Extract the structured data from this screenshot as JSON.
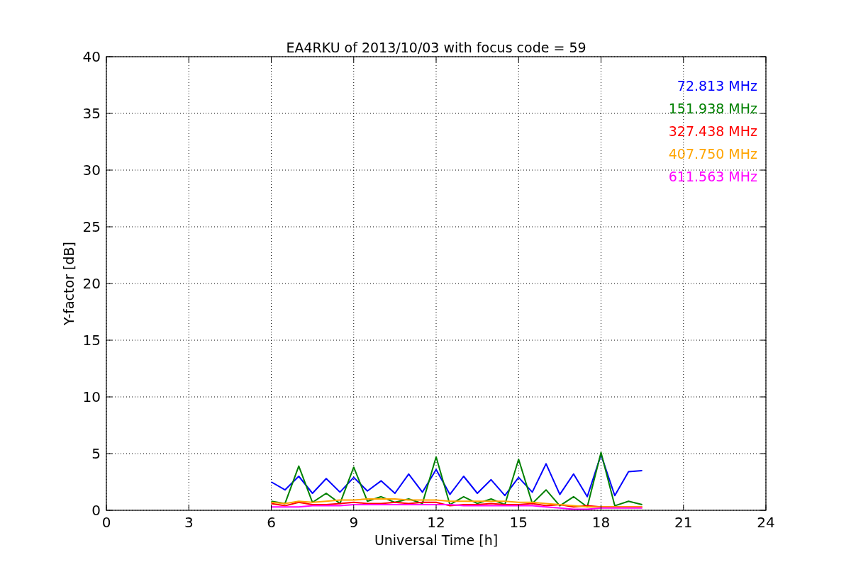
{
  "chart_data": {
    "type": "line",
    "title": "EA4RKU of 2013/10/03 with focus code = 59",
    "xlabel": "Universal Time [h]",
    "ylabel": "Y-factor [dB]",
    "x": [
      6,
      6.5,
      7,
      7.5,
      8,
      8.5,
      9,
      9.5,
      10,
      10.5,
      11,
      11.5,
      12,
      12.5,
      13,
      13.5,
      14,
      14.5,
      15,
      15.5,
      16,
      16.5,
      17,
      17.5,
      18,
      18.5,
      19,
      19.5
    ],
    "series": [
      {
        "name": "72.813 MHz",
        "color": "#0000ff",
        "values": [
          2.5,
          1.8,
          3.0,
          1.5,
          2.8,
          1.6,
          2.9,
          1.7,
          2.6,
          1.5,
          3.2,
          1.6,
          3.6,
          1.4,
          3.0,
          1.5,
          2.7,
          1.3,
          2.9,
          1.6,
          4.1,
          1.4,
          3.2,
          1.2,
          4.9,
          1.3,
          3.4,
          3.5
        ]
      },
      {
        "name": "151.938 MHz",
        "color": "#008000",
        "values": [
          0.8,
          0.6,
          3.9,
          0.7,
          1.5,
          0.6,
          3.8,
          0.8,
          1.2,
          0.7,
          1.0,
          0.6,
          4.7,
          0.5,
          1.2,
          0.6,
          1.0,
          0.5,
          4.5,
          0.6,
          1.8,
          0.4,
          1.2,
          0.3,
          5.1,
          0.4,
          0.8,
          0.5
        ]
      },
      {
        "name": "327.438 MHz",
        "color": "#ff0000",
        "values": [
          0.6,
          0.4,
          0.7,
          0.5,
          0.5,
          0.6,
          0.7,
          0.6,
          0.6,
          0.7,
          0.6,
          0.7,
          0.7,
          0.4,
          0.5,
          0.5,
          0.6,
          0.5,
          0.5,
          0.6,
          0.4,
          0.5,
          0.3,
          0.4,
          0.3,
          0.3,
          0.3,
          0.3
        ]
      },
      {
        "name": "407.750 MHz",
        "color": "#ffa500",
        "values": [
          0.7,
          0.6,
          0.8,
          0.7,
          0.8,
          0.9,
          0.9,
          1.0,
          1.0,
          1.0,
          0.9,
          0.9,
          0.9,
          0.8,
          0.8,
          0.8,
          0.8,
          0.8,
          0.7,
          0.7,
          0.6,
          0.5,
          0.4,
          0.3,
          0.3,
          0.3,
          0.3,
          0.3
        ]
      },
      {
        "name": "611.563 MHz",
        "color": "#ff00ff",
        "values": [
          0.3,
          0.3,
          0.3,
          0.4,
          0.4,
          0.4,
          0.5,
          0.5,
          0.5,
          0.5,
          0.5,
          0.5,
          0.5,
          0.5,
          0.4,
          0.4,
          0.4,
          0.4,
          0.4,
          0.4,
          0.3,
          0.2,
          0.1,
          0.1,
          0.2,
          0.2,
          0.2,
          0.2
        ]
      }
    ],
    "xlim": [
      0,
      24
    ],
    "ylim": [
      0,
      40
    ],
    "xticks": [
      0,
      3,
      6,
      9,
      12,
      15,
      18,
      21,
      24
    ],
    "yticks": [
      0,
      5,
      10,
      15,
      20,
      25,
      30,
      35,
      40
    ],
    "grid": true
  }
}
